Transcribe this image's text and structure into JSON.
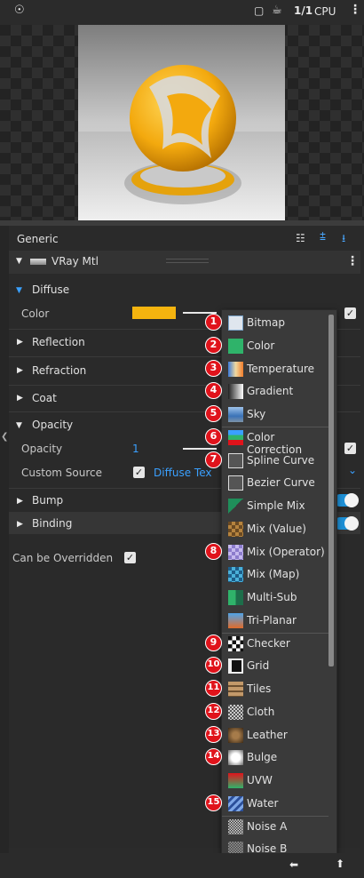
{
  "toolbar": {
    "page_indicator": "1/1",
    "device": "CPU"
  },
  "panel": {
    "header": "Generic",
    "material": "VRay Mtl",
    "sections": {
      "diffuse": "Diffuse",
      "reflection": "Reflection",
      "refraction": "Refraction",
      "coat": "Coat",
      "opacity": "Opacity",
      "bump": "Bump",
      "binding": "Binding"
    },
    "color_label": "Color",
    "diffuse_color": "#f5b40f",
    "opacity_label": "Opacity",
    "opacity_value": "1",
    "custom_source_label": "Custom Source",
    "custom_source_value": "Diffuse Tex",
    "can_be_overridden": "Can be Overridden"
  },
  "menu": {
    "items": [
      {
        "label": "Bitmap",
        "icon": "bitmap-icon",
        "badge": "1"
      },
      {
        "label": "Color",
        "icon": "color-swatch-icon",
        "badge": "2"
      },
      {
        "label": "Temperature",
        "icon": "temperature-icon",
        "badge": "3"
      },
      {
        "label": "Gradient",
        "icon": "gradient-icon",
        "badge": "4"
      },
      {
        "label": "Sky",
        "icon": "sky-icon",
        "badge": "5"
      },
      {
        "label": "Color Correction",
        "icon": "color-correction-icon",
        "badge": "6"
      },
      {
        "label": "Spline Curve",
        "icon": "spline-curve-icon",
        "badge": "7"
      },
      {
        "label": "Bezier Curve",
        "icon": "bezier-curve-icon",
        "badge": ""
      },
      {
        "label": "Simple Mix",
        "icon": "simple-mix-icon",
        "badge": ""
      },
      {
        "label": "Mix (Value)",
        "icon": "mix-value-icon",
        "badge": ""
      },
      {
        "label": "Mix (Operator)",
        "icon": "mix-operator-icon",
        "badge": "8"
      },
      {
        "label": "Mix (Map)",
        "icon": "mix-map-icon",
        "badge": ""
      },
      {
        "label": "Multi-Sub",
        "icon": "multi-sub-icon",
        "badge": ""
      },
      {
        "label": "Tri-Planar",
        "icon": "tri-planar-icon",
        "badge": ""
      },
      {
        "label": "Checker",
        "icon": "checker-icon",
        "badge": "9"
      },
      {
        "label": "Grid",
        "icon": "grid-icon",
        "badge": "10"
      },
      {
        "label": "Tiles",
        "icon": "tiles-icon",
        "badge": "11"
      },
      {
        "label": "Cloth",
        "icon": "cloth-icon",
        "badge": "12"
      },
      {
        "label": "Leather",
        "icon": "leather-icon",
        "badge": "13"
      },
      {
        "label": "Bulge",
        "icon": "bulge-icon",
        "badge": "14"
      },
      {
        "label": "UVW",
        "icon": "uvw-icon",
        "badge": ""
      },
      {
        "label": "Water",
        "icon": "water-icon",
        "badge": "15"
      },
      {
        "label": "Noise A",
        "icon": "noise-a-icon",
        "badge": ""
      },
      {
        "label": "Noise B",
        "icon": "noise-b-icon",
        "badge": ""
      }
    ]
  },
  "colors": {
    "accent": "#1e90d6",
    "badge": "#e0131b",
    "diffuse": "#f5b40f"
  }
}
